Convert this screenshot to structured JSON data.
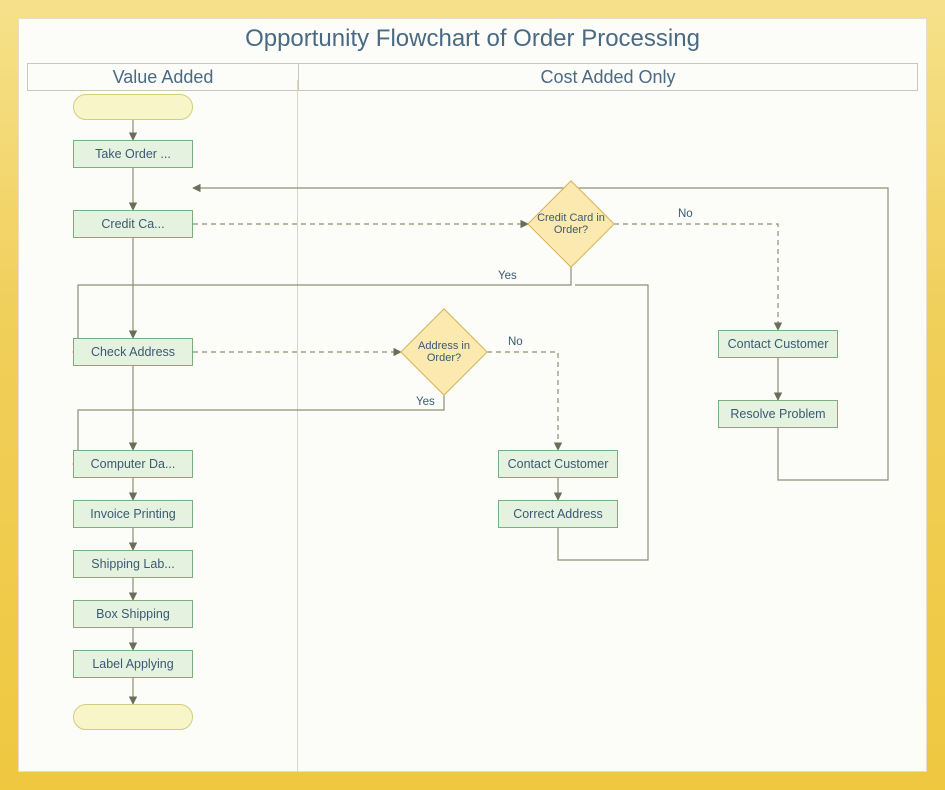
{
  "title": "Opportunity Flowchart of Order Processing",
  "lanes": {
    "left": "Value Added",
    "right": "Cost Added Only"
  },
  "nodes": {
    "start": {
      "label": ""
    },
    "take_order": {
      "label": "Take Order ..."
    },
    "credit_ca": {
      "label": "Credit Ca..."
    },
    "check_address": {
      "label": "Check Address"
    },
    "computer_da": {
      "label": "Computer Da..."
    },
    "invoice_printing": {
      "label": "Invoice Printing"
    },
    "shipping_lab": {
      "label": "Shipping Lab..."
    },
    "box_shipping": {
      "label": "Box Shipping"
    },
    "label_applying": {
      "label": "Label Applying"
    },
    "end": {
      "label": ""
    },
    "dec_credit": {
      "label": "Credit Card in Order?"
    },
    "dec_address": {
      "label": "Address in Order?"
    },
    "contact_cust_1": {
      "label": "Contact Customer"
    },
    "correct_address": {
      "label": "Correct Address"
    },
    "contact_cust_2": {
      "label": "Contact Customer"
    },
    "resolve_problem": {
      "label": "Resolve Problem"
    }
  },
  "edge_labels": {
    "credit_yes": "Yes",
    "credit_no": "No",
    "address_yes": "Yes",
    "address_no": "No"
  }
}
